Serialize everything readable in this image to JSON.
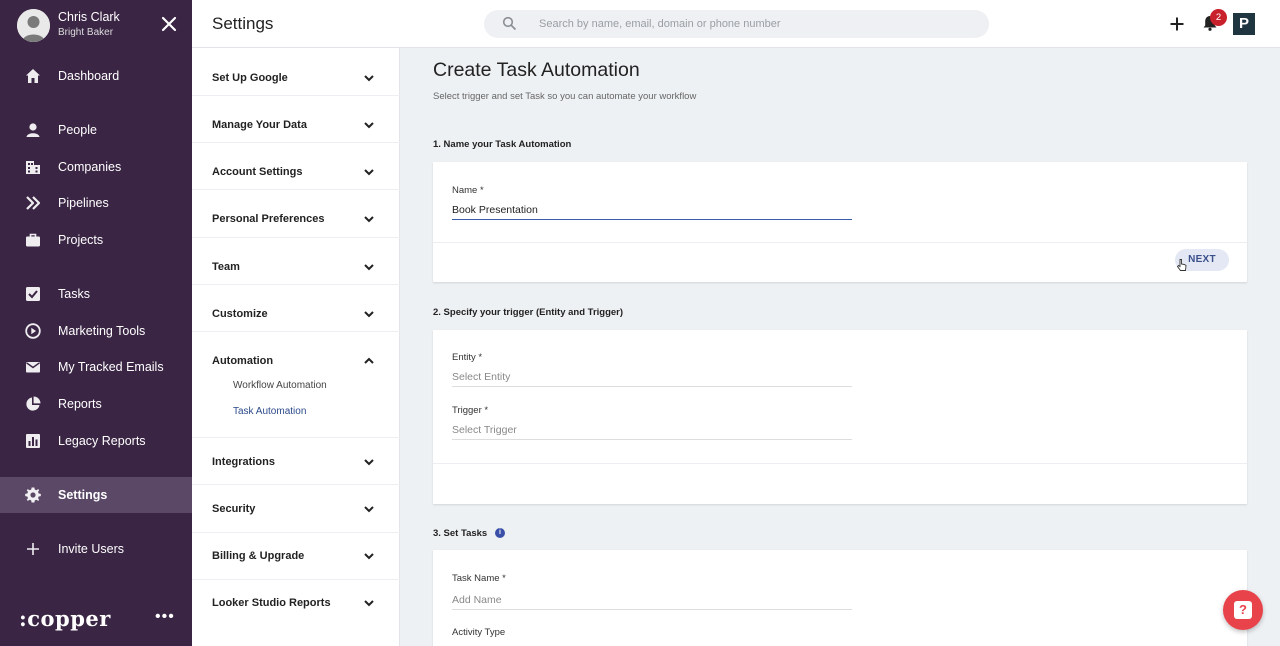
{
  "user": {
    "name": "Chris Clark",
    "org": "Bright Baker"
  },
  "nav": {
    "items": [
      {
        "label": "Dashboard",
        "icon": "home-icon"
      },
      {
        "label": "People",
        "icon": "person-icon"
      },
      {
        "label": "Companies",
        "icon": "building-icon"
      },
      {
        "label": "Pipelines",
        "icon": "double-chevron-icon"
      },
      {
        "label": "Projects",
        "icon": "briefcase-icon"
      },
      {
        "label": "Tasks",
        "icon": "checkbox-icon"
      },
      {
        "label": "Marketing Tools",
        "icon": "play-circle-icon"
      },
      {
        "label": "My Tracked Emails",
        "icon": "envelope-icon"
      },
      {
        "label": "Reports",
        "icon": "pie-chart-icon"
      },
      {
        "label": "Legacy Reports",
        "icon": "bar-chart-icon"
      },
      {
        "label": "Settings",
        "icon": "gear-icon",
        "active": true
      },
      {
        "label": "Invite Users",
        "icon": "plus-icon"
      }
    ],
    "brand": ":copper",
    "more": "•••"
  },
  "header": {
    "title": "Settings",
    "search_placeholder": "Search by name, email, domain or phone number",
    "notification_count": "2",
    "logo_letter": "P"
  },
  "settings_menu": {
    "items": [
      {
        "label": "Set Up Google"
      },
      {
        "label": "Manage Your Data"
      },
      {
        "label": "Account Settings"
      },
      {
        "label": "Personal Preferences"
      },
      {
        "label": "Team"
      },
      {
        "label": "Customize"
      },
      {
        "label": "Automation",
        "expanded": true
      },
      {
        "label": "Integrations"
      },
      {
        "label": "Security"
      },
      {
        "label": "Billing & Upgrade"
      },
      {
        "label": "Looker Studio Reports"
      }
    ],
    "automation_sub": [
      {
        "label": "Workflow Automation"
      },
      {
        "label": "Task Automation",
        "active": true
      }
    ]
  },
  "main": {
    "title": "Create Task Automation",
    "subtitle": "Select trigger and set Task so you can automate your workflow",
    "step1": {
      "title": "1. Name your Task Automation",
      "name_label": "Name *",
      "name_value": "Book Presentation",
      "next_label": "NEXT"
    },
    "step2": {
      "title": "2. Specify your trigger (Entity and Trigger)",
      "entity_label": "Entity *",
      "entity_placeholder": "Select Entity",
      "trigger_label": "Trigger *",
      "trigger_placeholder": "Select Trigger"
    },
    "step3": {
      "title": "3. Set Tasks",
      "info": "i",
      "task_name_label": "Task Name *",
      "task_name_placeholder": "Add Name",
      "activity_type_label": "Activity Type"
    }
  },
  "help": {
    "glyph": "?"
  },
  "colors": {
    "nav_bg": "#3a2544",
    "accent": "#3a5aa8",
    "badge": "#c9212c",
    "help": "#e8434a"
  }
}
